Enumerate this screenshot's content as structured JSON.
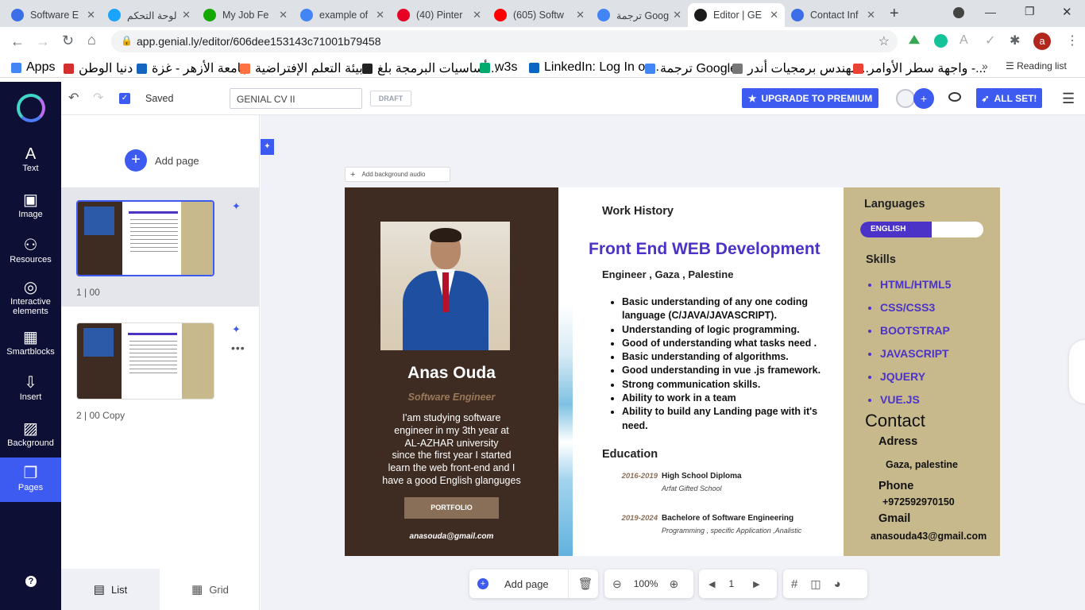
{
  "browser": {
    "tabs": [
      {
        "title": "Software E",
        "color": "#3b6ee8"
      },
      {
        "title": "لوحة التحكم",
        "color": "#1aa3ff"
      },
      {
        "title": "My Job Fe",
        "color": "#14a800"
      },
      {
        "title": "example of",
        "color": "#4285f4"
      },
      {
        "title": "(40) Pinter",
        "color": "#e60023"
      },
      {
        "title": "(605) Softw",
        "color": "#ff0000"
      },
      {
        "title": "ترجمة Google",
        "color": "#4285f4"
      },
      {
        "title": "Editor | GE",
        "color": "#1b1b1b"
      },
      {
        "title": "Contact Inf",
        "color": "#3b6ee8"
      }
    ],
    "url": "app.genial.ly/editor/606dee153143c71001b79458",
    "avatar_letter": "a",
    "bookmarks": [
      {
        "label": "Apps",
        "color": "#4285f4"
      },
      {
        "label": "دنيا الوطن",
        "color": "#d32f2f"
      },
      {
        "label": "جامعة الأزهر - غزة",
        "color": "#1565c0"
      },
      {
        "label": "بيئة التعلم الإفتراضية...",
        "color": "#ff7043"
      },
      {
        "label": "أساسيات البرمجة بلغ...",
        "color": "#222222"
      },
      {
        "label": "w3s",
        "color": "#04aa6d"
      },
      {
        "label": "LinkedIn: Log In or...",
        "color": "#0a66c2"
      },
      {
        "label": "ترجمة Google",
        "color": "#4285f4"
      },
      {
        "label": "مهندس برمجيات أندر...",
        "color": "#777777"
      },
      {
        "label": "واجهة سطر الأوامر -...",
        "color": "#ea4335"
      }
    ],
    "reading_list": "Reading list"
  },
  "rail": {
    "items": [
      {
        "label": "Text",
        "icon": "text-icon"
      },
      {
        "label": "Image",
        "icon": "image-icon"
      },
      {
        "label": "Resources",
        "icon": "resources-icon"
      },
      {
        "label": "Interactive elements",
        "icon": "interactive-icon"
      },
      {
        "label": "Smartblocks",
        "icon": "smartblocks-icon"
      },
      {
        "label": "Insert",
        "icon": "insert-icon"
      },
      {
        "label": "Background",
        "icon": "background-icon"
      },
      {
        "label": "Pages",
        "icon": "pages-icon"
      }
    ],
    "help": "?"
  },
  "topbar": {
    "saved": "Saved",
    "title_value": "GENIAL CV II",
    "draft": "DRAFT",
    "upgrade": "UPGRADE TO PREMIUM",
    "all_set": "ALL SET!"
  },
  "panel": {
    "add_page": "Add page",
    "pages": [
      {
        "num": "1",
        "name": "00"
      },
      {
        "num": "2",
        "name": "00 Copy"
      }
    ],
    "list_label": "List",
    "grid_label": "Grid"
  },
  "canvas": {
    "add_audio": "Add background audio",
    "bottom": {
      "add_page": "Add page",
      "zoom": "100%",
      "page": "1"
    }
  },
  "cv": {
    "name": "Anas Ouda",
    "role": "Software Engineer",
    "about": [
      "I'am studying software",
      "engineer in my 3th year at",
      "AL-AZHAR university",
      "since the first year I started",
      "learn the web front-end  and I",
      "have a good English glanguges"
    ],
    "portfolio": "PORTFOLIO",
    "email_left": "anasouda@gmail.com",
    "work_history": "Work History",
    "headline": "Front End WEB Development",
    "subline": "Engineer , Gaza , Palestine",
    "bullets": [
      "Basic understanding of any one coding language (C/JAVA/JAVASCRIPT).",
      "Understanding of logic programming.",
      "Good of understanding what tasks need .",
      "Basic understanding of algorithms.",
      "Good understanding in vue .js framework.",
      "Strong communication skills.",
      "Ability to work in a team",
      "Ability to build any Landing page with it's need."
    ],
    "education": "Education",
    "edu": [
      {
        "years": "2016-2019",
        "title": "High School Diploma",
        "sub": "Arfat Gifted School"
      },
      {
        "years": "2019-2024",
        "title": "Bachelore of Software Engineering",
        "sub": "Programming , specific Application ,Analistic"
      }
    ],
    "languages": "Languages",
    "lang_bar": "ENGLISH",
    "lang_level": 0.58,
    "skills": "Skills",
    "skill_list": [
      "HTML/HTML5",
      "CSS/CSS3",
      "BOOTSTRAP",
      "JAVASCRIPT",
      "JQUERY",
      "VUE.JS"
    ],
    "contact": "Contact",
    "adress_label": "Adress",
    "adress": "Gaza, palestine",
    "phone_label": "Phone",
    "phone": "+972592970150",
    "gmail_label": "Gmail",
    "gmail": "anasouda43@gmail.com"
  },
  "colors": {
    "rail": "#0d1034",
    "accent": "#3d5af1",
    "cv_dark": "#3e2c23",
    "cv_sand": "#c8b98d",
    "headline": "#4b33c8"
  }
}
